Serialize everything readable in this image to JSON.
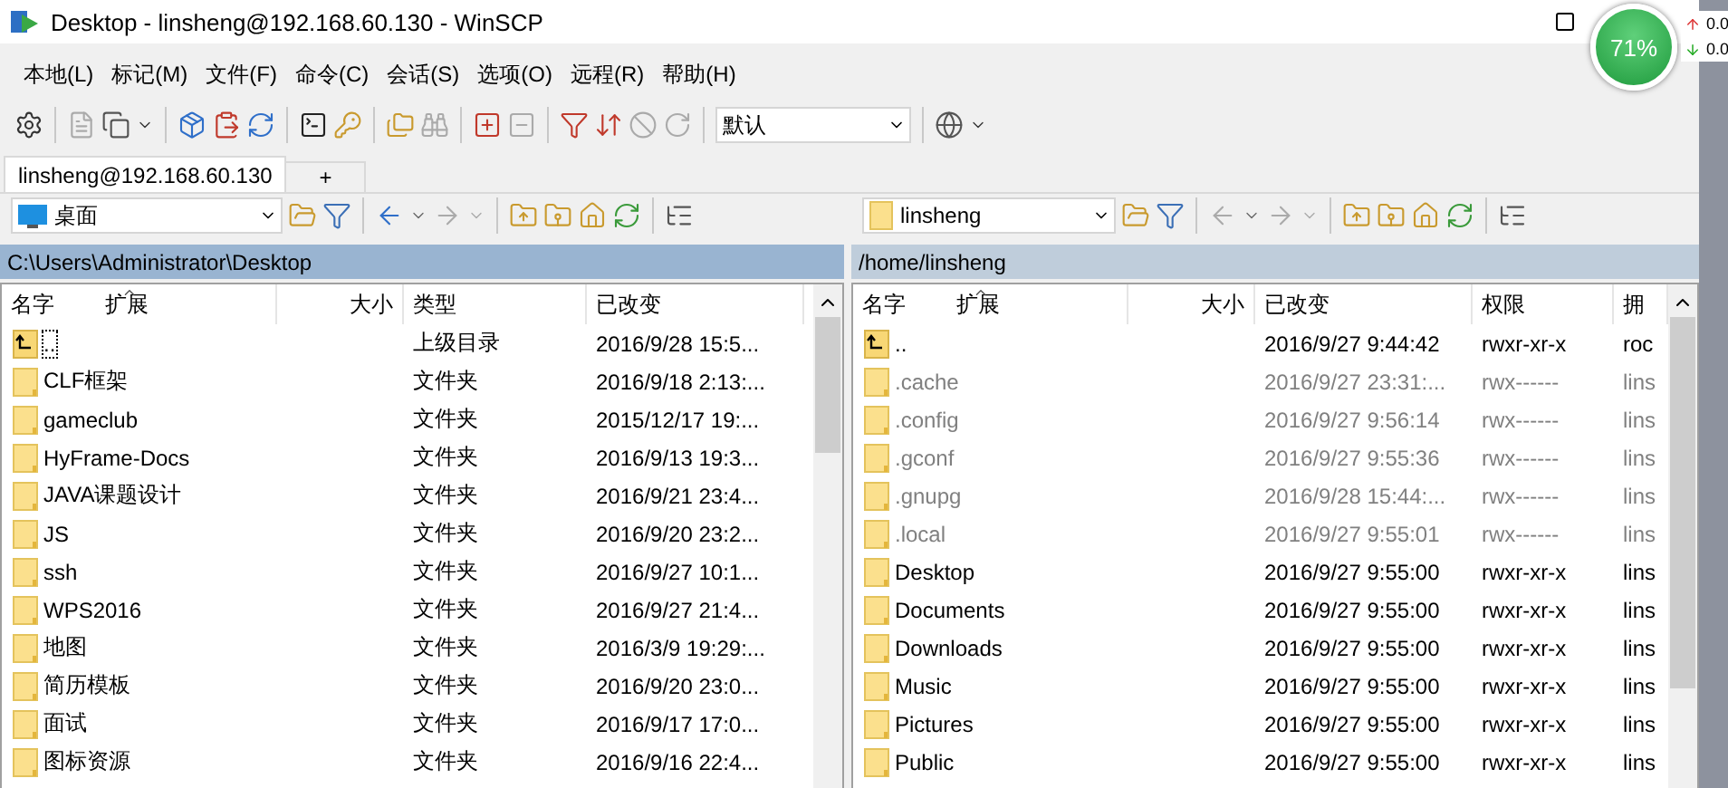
{
  "window": {
    "title": "Desktop - linsheng@192.168.60.130 - WinSCP"
  },
  "overlay": {
    "percent": "71%",
    "upload": "0.0",
    "download": "0.0"
  },
  "menu": [
    "本地(L)",
    "标记(M)",
    "文件(F)",
    "命令(C)",
    "会话(S)",
    "选项(O)",
    "远程(R)",
    "帮助(H)"
  ],
  "toolbar": {
    "preset": "默认"
  },
  "tabs": [
    {
      "label": "linsheng@192.168.60.130",
      "selected": true
    },
    {
      "label": "+",
      "selected": false
    }
  ],
  "panels": [
    {
      "location": "桌面",
      "kind": "local",
      "path": "C:\\Users\\Administrator\\Desktop",
      "active": true,
      "columns": [
        {
          "kind": "name",
          "label": "名字",
          "extra": "扩展",
          "sorted": true
        },
        {
          "kind": "size",
          "label": "大小"
        },
        {
          "kind": "text",
          "label": "类型"
        },
        {
          "kind": "text",
          "label": "已改变"
        }
      ],
      "rows": [
        {
          "kind": "parent",
          "cells": [
            "..",
            "",
            "上级目录",
            "2016/9/28  15:5..."
          ],
          "hidden": false,
          "focused": true
        },
        {
          "kind": "folder",
          "cells": [
            "CLF框架",
            "",
            "文件夹",
            "2016/9/18  2:13:..."
          ],
          "hidden": false,
          "focused": false
        },
        {
          "kind": "folder",
          "cells": [
            "gameclub",
            "",
            "文件夹",
            "2015/12/17  19:..."
          ],
          "hidden": false,
          "focused": false
        },
        {
          "kind": "folder",
          "cells": [
            "HyFrame-Docs",
            "",
            "文件夹",
            "2016/9/13  19:3..."
          ],
          "hidden": false,
          "focused": false
        },
        {
          "kind": "folder",
          "cells": [
            "JAVA课题设计",
            "",
            "文件夹",
            "2016/9/21  23:4..."
          ],
          "hidden": false,
          "focused": false
        },
        {
          "kind": "folder",
          "cells": [
            "JS",
            "",
            "文件夹",
            "2016/9/20  23:2..."
          ],
          "hidden": false,
          "focused": false
        },
        {
          "kind": "folder",
          "cells": [
            "ssh",
            "",
            "文件夹",
            "2016/9/27  10:1..."
          ],
          "hidden": false,
          "focused": false
        },
        {
          "kind": "folder",
          "cells": [
            "WPS2016",
            "",
            "文件夹",
            "2016/9/27  21:4..."
          ],
          "hidden": false,
          "focused": false
        },
        {
          "kind": "folder",
          "cells": [
            "地图",
            "",
            "文件夹",
            "2016/3/9  19:29:..."
          ],
          "hidden": false,
          "focused": false
        },
        {
          "kind": "folder",
          "cells": [
            "简历模板",
            "",
            "文件夹",
            "2016/9/20  23:0..."
          ],
          "hidden": false,
          "focused": false
        },
        {
          "kind": "folder",
          "cells": [
            "面试",
            "",
            "文件夹",
            "2016/9/17  17:0..."
          ],
          "hidden": false,
          "focused": false
        },
        {
          "kind": "folder",
          "cells": [
            "图标资源",
            "",
            "文件夹",
            "2016/9/16  22:4..."
          ],
          "hidden": false,
          "focused": false
        }
      ]
    },
    {
      "location": "linsheng",
      "kind": "remote",
      "path": "/home/linsheng",
      "active": false,
      "columns": [
        {
          "kind": "name",
          "label": "名字",
          "extra": "扩展",
          "sorted": true
        },
        {
          "kind": "size",
          "label": "大小"
        },
        {
          "kind": "text",
          "label": "已改变"
        },
        {
          "kind": "text",
          "label": "权限"
        },
        {
          "kind": "text",
          "label": "拥"
        }
      ],
      "rows": [
        {
          "kind": "parent",
          "cells": [
            "..",
            "",
            "2016/9/27 9:44:42",
            "rwxr-xr-x",
            "roc"
          ],
          "hidden": false,
          "focused": false
        },
        {
          "kind": "folder",
          "cells": [
            ".cache",
            "",
            "2016/9/27 23:31:...",
            "rwx------",
            "lins"
          ],
          "hidden": true,
          "focused": false
        },
        {
          "kind": "folder",
          "cells": [
            ".config",
            "",
            "2016/9/27 9:56:14",
            "rwx------",
            "lins"
          ],
          "hidden": true,
          "focused": false
        },
        {
          "kind": "folder",
          "cells": [
            ".gconf",
            "",
            "2016/9/27 9:55:36",
            "rwx------",
            "lins"
          ],
          "hidden": true,
          "focused": false
        },
        {
          "kind": "folder",
          "cells": [
            ".gnupg",
            "",
            "2016/9/28 15:44:...",
            "rwx------",
            "lins"
          ],
          "hidden": true,
          "focused": false
        },
        {
          "kind": "folder",
          "cells": [
            ".local",
            "",
            "2016/9/27 9:55:01",
            "rwx------",
            "lins"
          ],
          "hidden": true,
          "focused": false
        },
        {
          "kind": "folder",
          "cells": [
            "Desktop",
            "",
            "2016/9/27 9:55:00",
            "rwxr-xr-x",
            "lins"
          ],
          "hidden": false,
          "focused": false
        },
        {
          "kind": "folder",
          "cells": [
            "Documents",
            "",
            "2016/9/27 9:55:00",
            "rwxr-xr-x",
            "lins"
          ],
          "hidden": false,
          "focused": false
        },
        {
          "kind": "folder",
          "cells": [
            "Downloads",
            "",
            "2016/9/27 9:55:00",
            "rwxr-xr-x",
            "lins"
          ],
          "hidden": false,
          "focused": false
        },
        {
          "kind": "folder",
          "cells": [
            "Music",
            "",
            "2016/9/27 9:55:00",
            "rwxr-xr-x",
            "lins"
          ],
          "hidden": false,
          "focused": false
        },
        {
          "kind": "folder",
          "cells": [
            "Pictures",
            "",
            "2016/9/27 9:55:00",
            "rwxr-xr-x",
            "lins"
          ],
          "hidden": false,
          "focused": false
        },
        {
          "kind": "folder",
          "cells": [
            "Public",
            "",
            "2016/9/27 9:55:00",
            "rwxr-xr-x",
            "lins"
          ],
          "hidden": false,
          "focused": false
        }
      ]
    }
  ]
}
